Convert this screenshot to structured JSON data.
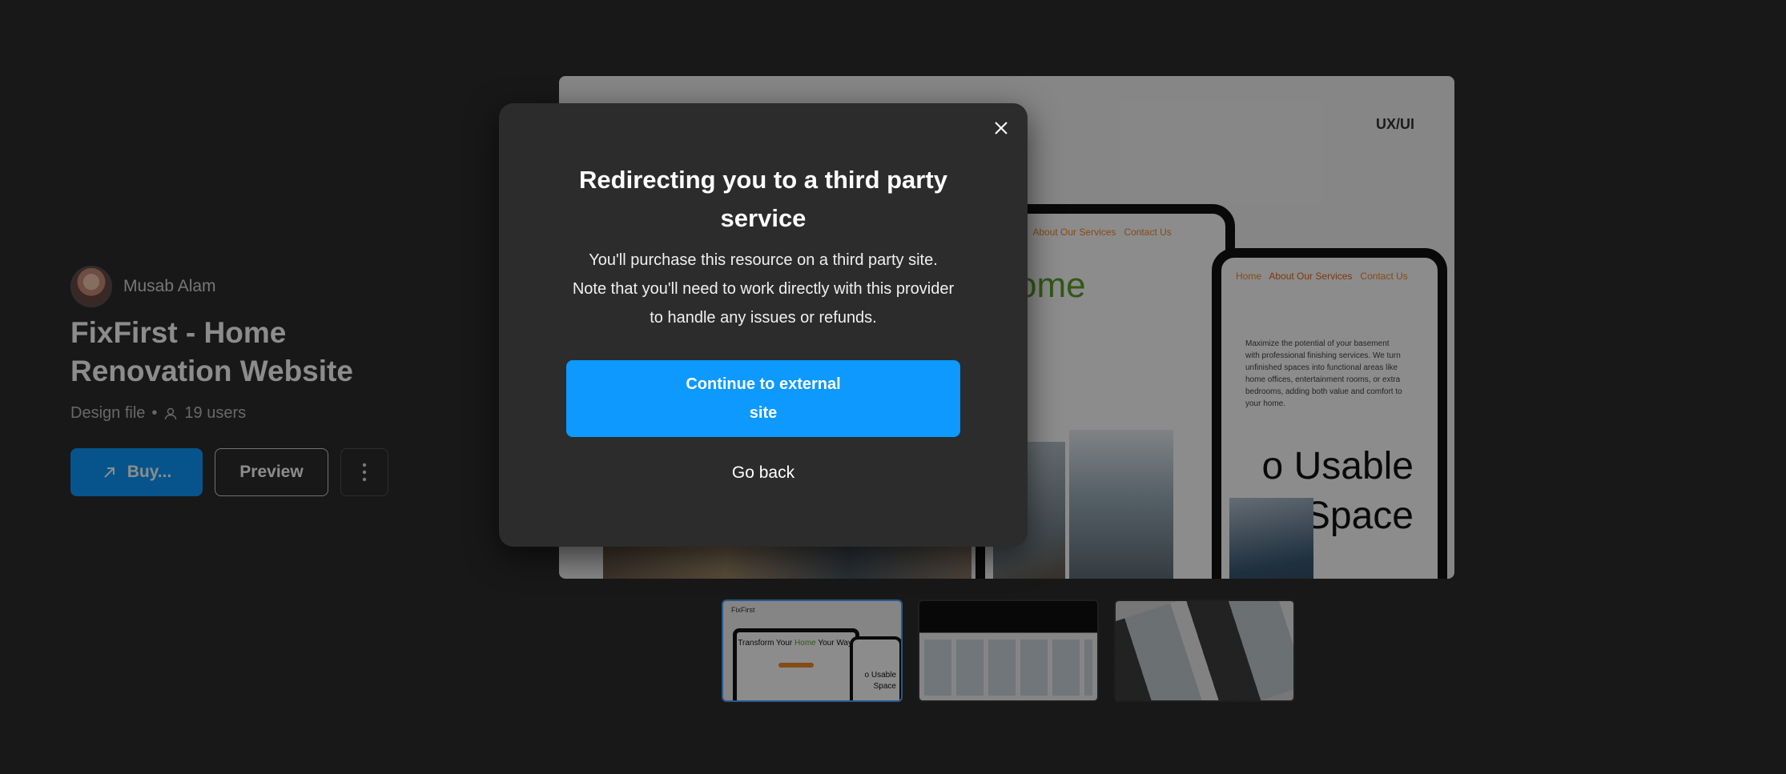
{
  "author": {
    "name": "Musab Alam"
  },
  "resource": {
    "title": "FixFirst - Home Renovation Website",
    "type": "Design file",
    "separator": "•",
    "users": "19 users"
  },
  "actions": {
    "buy_label": "Buy...",
    "preview_label": "Preview"
  },
  "preview": {
    "tag": "UX/UI",
    "nav_items": [
      "Home",
      "About Our Services",
      "Contact Us"
    ],
    "hero_word": "ome",
    "description": "Maximize the potential of your basement with professional finishing services. We turn unfinished spaces into functional areas like home offices, entertainment rooms, or extra bedrooms, adding both value and comfort to your home.",
    "usable_line1": "o Usable",
    "usable_line2": "Space"
  },
  "thumbnails": [
    {
      "logo": "FixFirst",
      "title_a": "Transform Your ",
      "title_highlight": "Home",
      "title_b": " Your Way!",
      "usable": "o Usable Space",
      "active": true
    },
    {
      "active": false
    },
    {
      "active": false
    }
  ],
  "modal": {
    "title": "Redirecting you to a third party service",
    "body": "You'll purchase this resource on a third party site. Note that you'll need to work directly with this provider to handle any issues or refunds.",
    "continue_label": "Continue to external site",
    "back_label": "Go back"
  },
  "colors": {
    "accent": "#0d99ff",
    "page_bg": "#2c2c2c",
    "modal_bg": "#2c2c2c"
  },
  "icons": [
    "avatar",
    "user-icon",
    "external-arrow-icon",
    "more-vertical-icon",
    "close-icon"
  ]
}
